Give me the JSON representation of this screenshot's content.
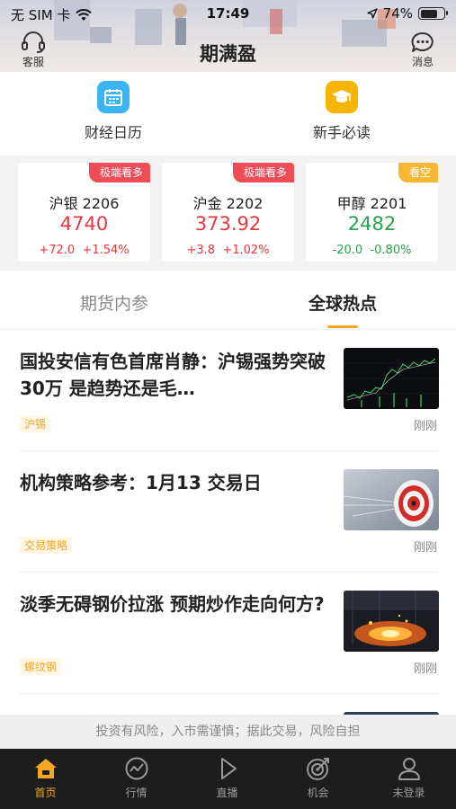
{
  "status_bar": {
    "carrier": "无 SIM 卡",
    "time": "17:49",
    "battery": "74%",
    "battery_level": 0.74
  },
  "header": {
    "title": "期满盈",
    "left_label": "客服",
    "right_label": "消息"
  },
  "shortcuts": [
    {
      "label": "财经日历",
      "icon": "calendar-icon",
      "color": "#3bb4f2"
    },
    {
      "label": "新手必读",
      "icon": "graduation-cap-icon",
      "color": "#f7b500"
    }
  ],
  "quotes": [
    {
      "name": "沪银 2206",
      "price": "4740",
      "change": "+72.0",
      "percent": "+1.54%",
      "tag": "极端看多",
      "dir": "up"
    },
    {
      "name": "沪金 2202",
      "price": "373.92",
      "change": "+3.8",
      "percent": "+1.02%",
      "tag": "极端看多",
      "dir": "up"
    },
    {
      "name": "甲醇 2201",
      "price": "2482",
      "change": "-20.0",
      "percent": "-0.80%",
      "tag": "看空",
      "dir": "down"
    }
  ],
  "colors": {
    "accent": "#f5a623",
    "up": "#e8383d",
    "down": "#2aa04a",
    "tag_up": "#ef4c57",
    "tag_down": "#f7b733"
  },
  "tabs": [
    {
      "label": "期货内参",
      "active": false
    },
    {
      "label": "全球热点",
      "active": true
    }
  ],
  "news": [
    {
      "title": "国投安信有色首席肖静：沪锡强势突破 30万 是趋势还是毛…",
      "tag": "沪锡",
      "time": "刚刚",
      "thumb": "stock-chart"
    },
    {
      "title": "机构策略参考：1月13 交易日",
      "tag": "交易策略",
      "time": "刚刚",
      "thumb": "target-dartboard"
    },
    {
      "title": "淡季无碍钢价拉涨 预期炒作走向何方?",
      "tag": "螺纹钢",
      "time": "刚刚",
      "thumb": "steel-mill"
    }
  ],
  "disclaimer": "投资有风险，入市需谨慎；据此交易，风险自担",
  "tabbar": [
    {
      "label": "首页",
      "icon": "home-icon",
      "active": true
    },
    {
      "label": "行情",
      "icon": "chart-icon",
      "active": false
    },
    {
      "label": "直播",
      "icon": "play-icon",
      "active": false
    },
    {
      "label": "机会",
      "icon": "target-icon",
      "active": false
    },
    {
      "label": "未登录",
      "icon": "user-icon",
      "active": false
    }
  ]
}
